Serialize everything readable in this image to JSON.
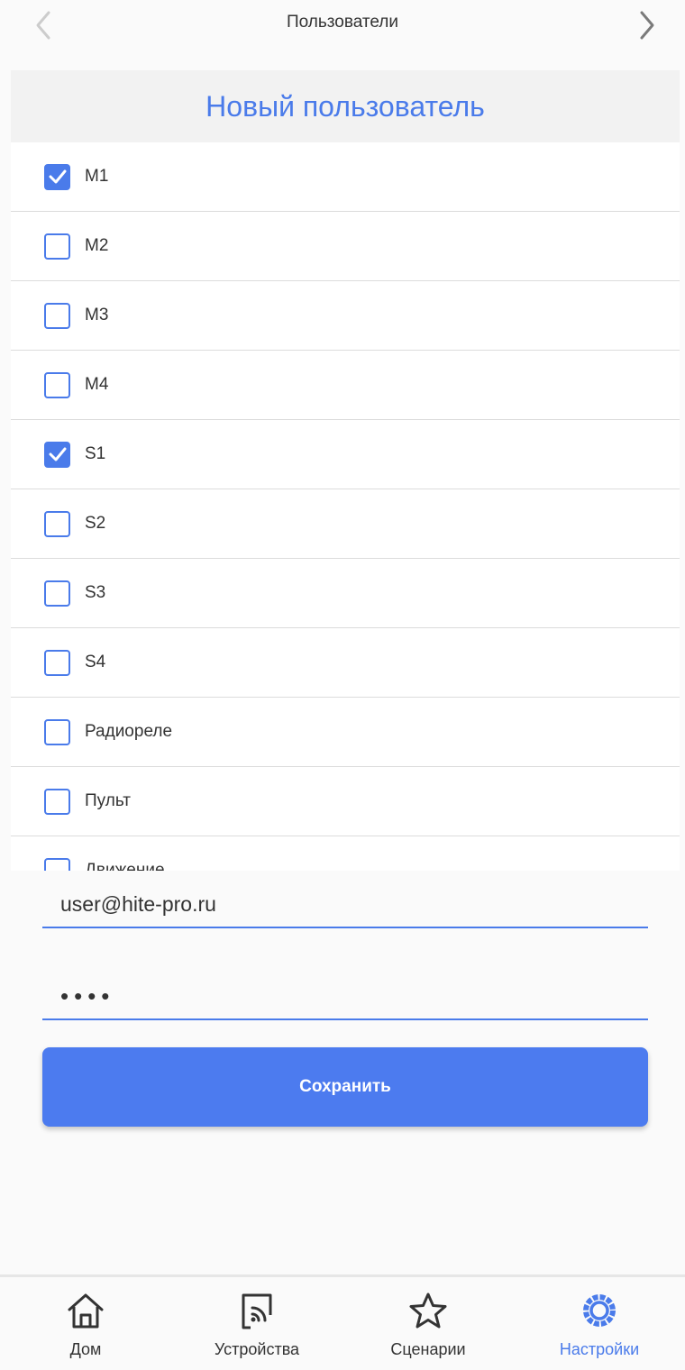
{
  "topbar": {
    "title": "Пользователи",
    "back_icon": "chevron-left-icon",
    "forward_icon": "chevron-right-icon"
  },
  "form": {
    "title": "Новый пользователь",
    "items": [
      {
        "label": "M1",
        "checked": true
      },
      {
        "label": "M2",
        "checked": false
      },
      {
        "label": "M3",
        "checked": false
      },
      {
        "label": "M4",
        "checked": false
      },
      {
        "label": "S1",
        "checked": true
      },
      {
        "label": "S2",
        "checked": false
      },
      {
        "label": "S3",
        "checked": false
      },
      {
        "label": "S4",
        "checked": false
      },
      {
        "label": "Радиореле",
        "checked": false
      },
      {
        "label": "Пульт",
        "checked": false
      },
      {
        "label": "Движение",
        "checked": false
      }
    ],
    "email_value": "user@hite-pro.ru",
    "password_value": "••••",
    "save_label": "Сохранить"
  },
  "tabbar": {
    "tabs": [
      {
        "label": "Дом",
        "icon": "home-icon",
        "active": false
      },
      {
        "label": "Устройства",
        "icon": "devices-icon",
        "active": false
      },
      {
        "label": "Сценарии",
        "icon": "star-icon",
        "active": false
      },
      {
        "label": "Настройки",
        "icon": "settings-gear-icon",
        "active": true
      }
    ]
  },
  "colors": {
    "accent": "#4a7bea",
    "button": "#4c7bef",
    "text": "#333333",
    "inactive_arrow": "#cccccc",
    "divider": "#dcdcdc"
  }
}
